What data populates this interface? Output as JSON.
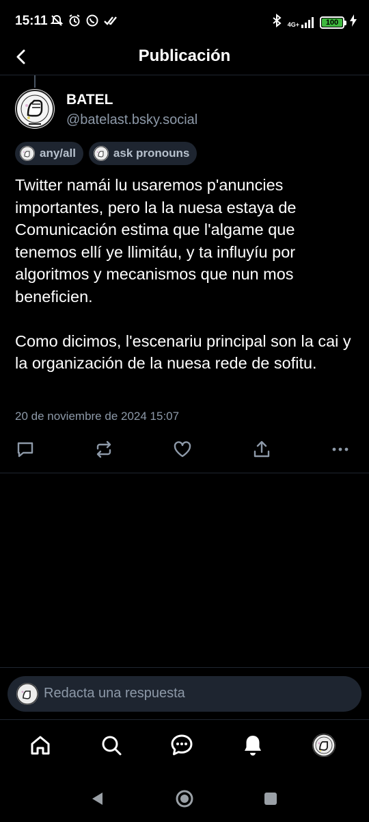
{
  "status_bar": {
    "time": "15:11",
    "network": "4G+",
    "battery": "100",
    "battery_level": 1.0,
    "battery_color": "#3fb83f"
  },
  "header": {
    "title": "Publicación"
  },
  "post": {
    "author_name": "BATEL",
    "author_handle": "@batelast.bsky.social",
    "pronouns": [
      {
        "label": "any/all"
      },
      {
        "label": "ask pronouns"
      }
    ],
    "text": "Twitter namái lu usaremos p'anuncies importantes, pero la la nuesa estaya de Comunicación estima que l'algame que tenemos ellí ye llimitáu, y ta influyíu por algoritmos y mecanismos que nun mos beneficien.\n\nComo dicimos, l'escenariu principal son la cai y la organización de la nuesa rede de sofitu.",
    "timestamp": "20 de noviembre de 2024 15:07",
    "actions": [
      {
        "icon": "reply-icon"
      },
      {
        "icon": "repost-icon"
      },
      {
        "icon": "like-icon"
      },
      {
        "icon": "share-icon"
      },
      {
        "icon": "more-icon"
      }
    ]
  },
  "composer": {
    "placeholder": "Redacta una respuesta"
  },
  "bottom_nav": [
    {
      "icon": "home-icon"
    },
    {
      "icon": "search-icon"
    },
    {
      "icon": "chat-icon"
    },
    {
      "icon": "notifications-icon"
    },
    {
      "icon": "profile-avatar"
    }
  ],
  "system_nav": [
    {
      "icon": "back-triangle-icon"
    },
    {
      "icon": "home-circle-icon"
    },
    {
      "icon": "recents-square-icon"
    }
  ],
  "colors": {
    "background": "#000000",
    "surface": "#1e2530",
    "muted_text": "#8d99a8",
    "divider": "#1f2630"
  }
}
